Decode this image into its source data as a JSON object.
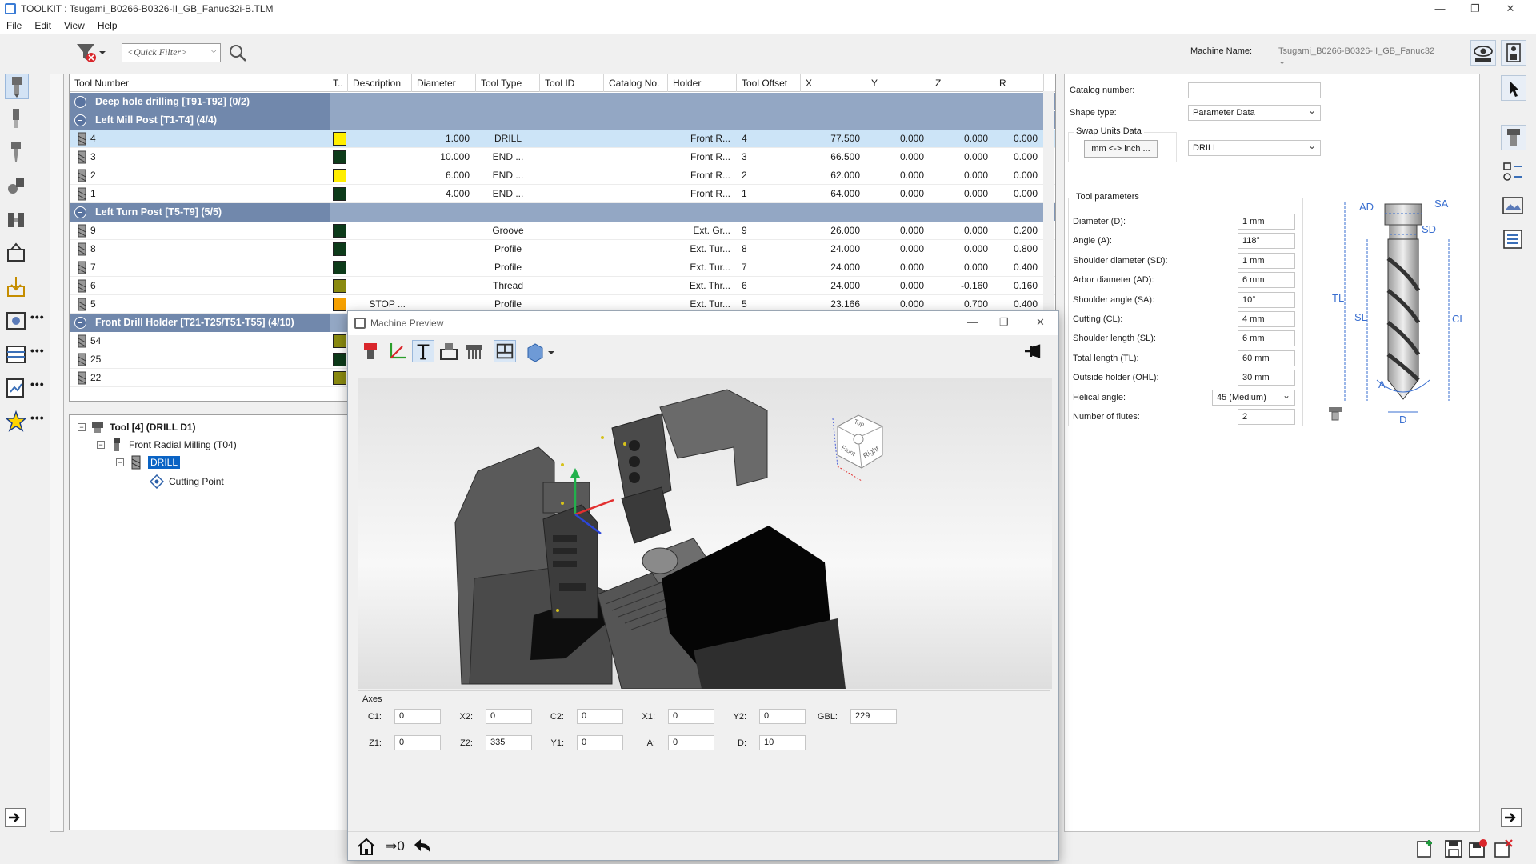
{
  "window": {
    "title": "TOOLKIT : Tsugami_B0266-B0326-II_GB_Fanuc32i-B.TLM",
    "minimize": "—",
    "maximize": "❐",
    "close": "✕"
  },
  "menu": [
    "File",
    "Edit",
    "View",
    "Help"
  ],
  "toolbar": {
    "quick_filter_placeholder": "<Quick Filter>",
    "machine_label": "Machine Name:",
    "machine_value": "Tsugami_B0266-B0326-II_GB_Fanuc32"
  },
  "table": {
    "columns": [
      "Tool Number",
      "T..",
      "Description",
      "Diameter",
      "Tool Type",
      "Tool ID",
      "Catalog No.",
      "Holder",
      "Tool Offset",
      "X",
      "Y",
      "Z",
      "R"
    ],
    "groups": [
      {
        "title": "Deep hole drilling [T91-T92] (0/2)",
        "rows": []
      },
      {
        "title": "Left Mill Post [T1-T4] (4/4)",
        "rows": [
          {
            "num": "4",
            "color": "#ffee00",
            "desc": "",
            "dia": "1.000",
            "type": "DRILL",
            "holder": "Front R...",
            "offset": "4",
            "x": "77.500",
            "y": "0.000",
            "z": "0.000",
            "r": "0.000",
            "selected": true
          },
          {
            "num": "3",
            "color": "#0d3b1a",
            "desc": "",
            "dia": "10.000",
            "type": "END ...",
            "holder": "Front R...",
            "offset": "3",
            "x": "66.500",
            "y": "0.000",
            "z": "0.000",
            "r": "0.000"
          },
          {
            "num": "2",
            "color": "#ffee00",
            "desc": "",
            "dia": "6.000",
            "type": "END ...",
            "holder": "Front R...",
            "offset": "2",
            "x": "62.000",
            "y": "0.000",
            "z": "0.000",
            "r": "0.000"
          },
          {
            "num": "1",
            "color": "#0d3b1a",
            "desc": "",
            "dia": "4.000",
            "type": "END ...",
            "holder": "Front R...",
            "offset": "1",
            "x": "64.000",
            "y": "0.000",
            "z": "0.000",
            "r": "0.000"
          }
        ]
      },
      {
        "title": "Left Turn Post [T5-T9] (5/5)",
        "rows": [
          {
            "num": "9",
            "color": "#0d3b1a",
            "desc": "",
            "dia": "",
            "type": "Groove",
            "holder": "Ext. Gr...",
            "offset": "9",
            "x": "26.000",
            "y": "0.000",
            "z": "0.000",
            "r": "0.200"
          },
          {
            "num": "8",
            "color": "#0d3b1a",
            "desc": "",
            "dia": "",
            "type": "Profile",
            "holder": "Ext. Tur...",
            "offset": "8",
            "x": "24.000",
            "y": "0.000",
            "z": "0.000",
            "r": "0.800"
          },
          {
            "num": "7",
            "color": "#0d3b1a",
            "desc": "",
            "dia": "",
            "type": "Profile",
            "holder": "Ext. Tur...",
            "offset": "7",
            "x": "24.000",
            "y": "0.000",
            "z": "0.000",
            "r": "0.400"
          },
          {
            "num": "6",
            "color": "#8a8a10",
            "desc": "",
            "dia": "",
            "type": "Thread",
            "holder": "Ext. Thr...",
            "offset": "6",
            "x": "24.000",
            "y": "0.000",
            "z": "-0.160",
            "r": "0.160"
          },
          {
            "num": "5",
            "color": "#f5a000",
            "desc": "STOP ...",
            "dia": "",
            "type": "Profile",
            "holder": "Ext. Tur...",
            "offset": "5",
            "x": "23.166",
            "y": "0.000",
            "z": "0.700",
            "r": "0.400"
          }
        ]
      },
      {
        "title": "Front Drill Holder [T21-T25/T51-T55] (4/10)",
        "rows": [
          {
            "num": "54",
            "color": "#8a8a10"
          },
          {
            "num": "25",
            "color": "#0d3b1a"
          },
          {
            "num": "22",
            "color": "#8a8a10"
          }
        ]
      }
    ]
  },
  "tree": {
    "root": "Tool [4] (DRILL D1)",
    "child": "Front Radial Milling (T04)",
    "leaf": "DRILL",
    "point": "Cutting Point"
  },
  "props": {
    "catalog_label": "Catalog number:",
    "catalog_value": "",
    "shape_label": "Shape type:",
    "shape_value": "Parameter Data",
    "swap_label": "Swap Units Data",
    "swap_button": "mm <-> inch ...",
    "type_value": "DRILL",
    "params_title": "Tool parameters",
    "params": [
      {
        "label": "Diameter (D):",
        "value": "1 mm"
      },
      {
        "label": "Angle (A):",
        "value": "118°"
      },
      {
        "label": "Shoulder diameter (SD):",
        "value": "1 mm"
      },
      {
        "label": "Arbor diameter (AD):",
        "value": "6 mm"
      },
      {
        "label": "Shoulder angle (SA):",
        "value": "10°"
      },
      {
        "label": "Cutting (CL):",
        "value": "4 mm"
      },
      {
        "label": "Shoulder length (SL):",
        "value": "6 mm"
      },
      {
        "label": "Total length (TL):",
        "value": "60 mm"
      },
      {
        "label": "Outside holder (OHL):",
        "value": "30 mm"
      },
      {
        "label": "Helical angle:",
        "value": "45 (Medium)"
      },
      {
        "label": "Number of flutes:",
        "value": "2"
      }
    ],
    "diagram_labels": {
      "ad": "AD",
      "sa": "SA",
      "sd": "SD",
      "tl": "TL",
      "sl": "SL",
      "cl": "CL",
      "a": "A",
      "d": "D"
    }
  },
  "preview": {
    "title": "Machine Preview",
    "axes_title": "Axes",
    "cube": {
      "top": "Top",
      "front": "Front",
      "right": "Right"
    },
    "axes": [
      {
        "label": "C1:",
        "value": "0"
      },
      {
        "label": "X2:",
        "value": "0"
      },
      {
        "label": "C2:",
        "value": "0"
      },
      {
        "label": "X1:",
        "value": "0"
      },
      {
        "label": "Y2:",
        "value": "0"
      },
      {
        "label": "GBL:",
        "value": "229"
      },
      {
        "label": "Z1:",
        "value": "0"
      },
      {
        "label": "Z2:",
        "value": "335"
      },
      {
        "label": "Y1:",
        "value": "0"
      },
      {
        "label": "A:",
        "value": "0"
      },
      {
        "label": "D:",
        "value": "10"
      }
    ],
    "footer_zero": "⇒0"
  }
}
